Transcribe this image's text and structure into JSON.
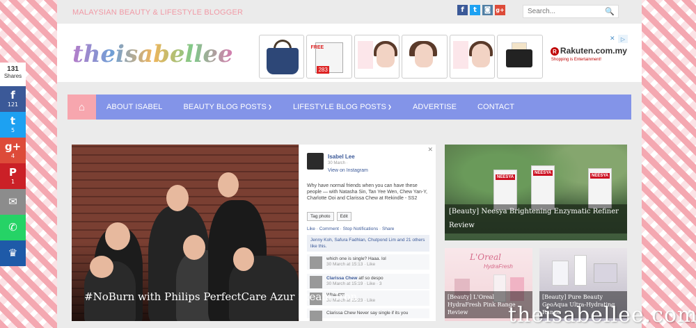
{
  "topbar": {
    "tagline": "MALAYSIAN BEAUTY & LIFESTYLE BLOGGER",
    "social": [
      {
        "icon": "facebook-icon",
        "glyph": "f",
        "color": "#3b5998"
      },
      {
        "icon": "twitter-icon",
        "glyph": "t",
        "color": "#1da1f2"
      },
      {
        "icon": "instagram-icon",
        "glyph": "◙",
        "color": "#517fa4"
      },
      {
        "icon": "google-plus-icon",
        "glyph": "g+",
        "color": "#dd4b39"
      }
    ],
    "search_placeholder": "Search..."
  },
  "header": {
    "logo_text": "theisabellee"
  },
  "ad": {
    "mini_text": "FREE",
    "price": "283",
    "rakuten": "Rakuten.com.my",
    "rakuten_sub": "Shopping is Entertainment!"
  },
  "nav": {
    "items": [
      {
        "label": "ABOUT ISABEL",
        "dropdown": false
      },
      {
        "label": "BEAUTY BLOG POSTS",
        "dropdown": true
      },
      {
        "label": "LIFESTYLE BLOG POSTS",
        "dropdown": true
      },
      {
        "label": "ADVERTISE",
        "dropdown": false
      },
      {
        "label": "CONTACT",
        "dropdown": false
      }
    ]
  },
  "featured": {
    "title": "#NoBurn with Philips PerfectCare Azur Steam Iron",
    "fb": {
      "name": "Isabel Lee",
      "date": "30 March · ",
      "link": "View on Instagram",
      "text": "Why have normal friends when you can have these people — with Natasha Sin, Tan Yee Wen, Chew Yan-Y, Charlotte Ooi and Clarissa Chew at Rekindle - SS2",
      "tag_photo": "Tag photo",
      "edit": "Edit",
      "actions": "Like · Comment · Stop Notifications · Share",
      "likes": "Jenny Koh, Safura Fadhlan, Chutpond Lim and 21 others like this.",
      "comment1": "which one is single? Haaa. lol",
      "comment1_meta": "30 March at 15:13 · Like",
      "comment2_name": "Clarissa Chew",
      "comment2": " atf so despo",
      "comment2_meta": "30 March at 15:19 · Like · 3",
      "comment3": "Whaattttt",
      "comment3_meta": "30 March at 15:23 · Like",
      "comment4": "Clarissa Chew Never say single if its you"
    }
  },
  "cards": [
    {
      "title": "[Beauty] Neesya Brightening Enzymatic Refiner Review",
      "brand": "NEESYA"
    },
    {
      "title": "[Beauty] L'Oreal HydraFresh Pink Range Review",
      "brand": "L'Oreal",
      "brand_sub": "HydraFresh"
    },
    {
      "title": "[Beauty] Pure Beauty GeoAqua Ultra-Hydrating Range"
    }
  ],
  "share_bar": {
    "total": "131",
    "total_label": "Shares",
    "buttons": [
      {
        "name": "facebook",
        "glyph": "f",
        "count": "121",
        "color": "#3b5998"
      },
      {
        "name": "twitter",
        "glyph": "t",
        "count": "5",
        "color": "#1da1f2"
      },
      {
        "name": "google-plus",
        "glyph": "g+",
        "count": "4",
        "color": "#dd4b39"
      },
      {
        "name": "pinterest",
        "glyph": "P",
        "count": "1",
        "color": "#cb2027"
      },
      {
        "name": "email",
        "glyph": "✉",
        "count": "",
        "color": "#8c8c8c"
      },
      {
        "name": "whatsapp",
        "glyph": "✆",
        "count": "",
        "color": "#25d366"
      },
      {
        "name": "sumo",
        "glyph": "♛",
        "count": "",
        "color": "#1e5aa8"
      }
    ]
  },
  "watermark": "theisabellee.com"
}
